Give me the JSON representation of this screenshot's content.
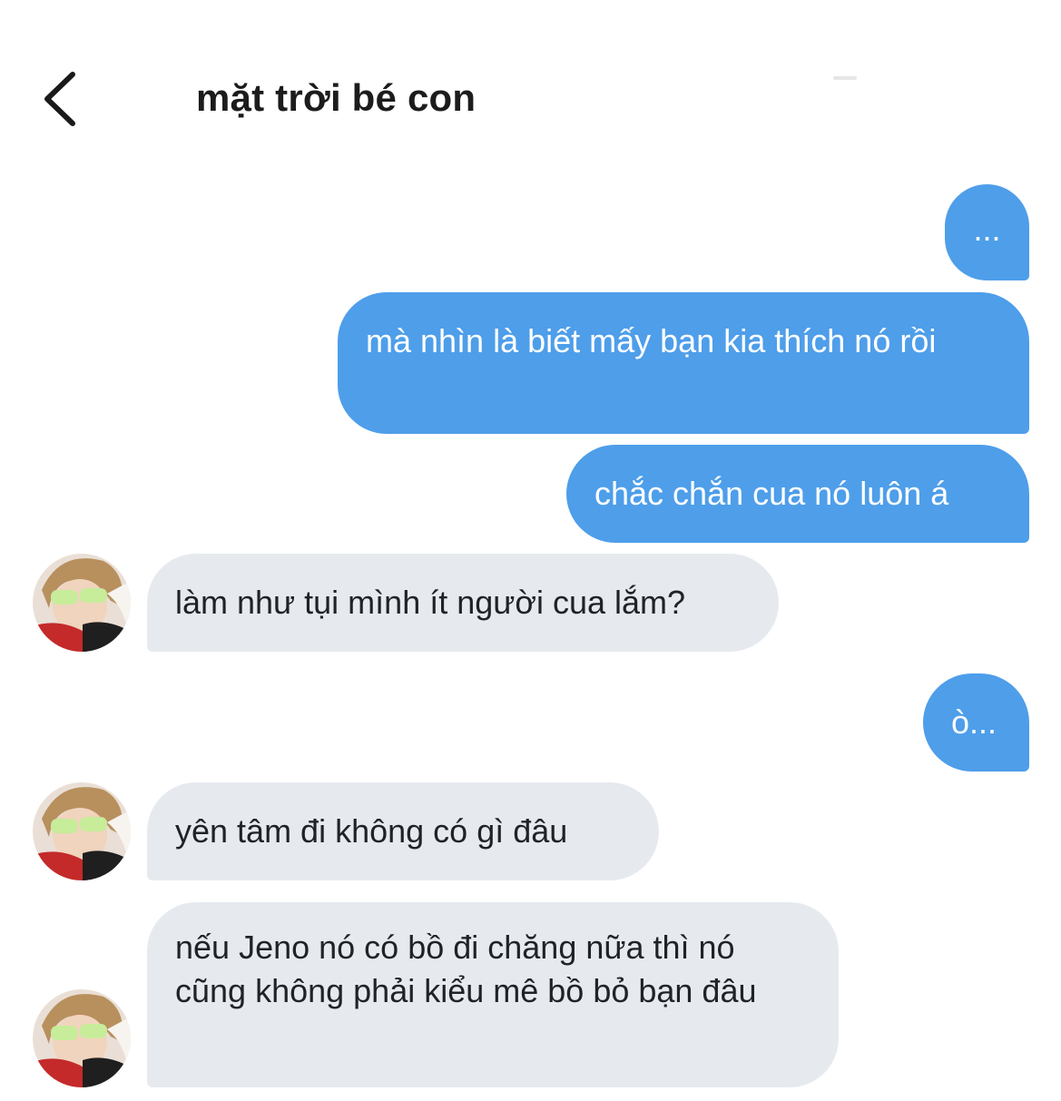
{
  "header": {
    "title": "mặt trời bé con",
    "back_icon": "chevron-left-icon"
  },
  "colors": {
    "sent_bubble": "#4e9eea",
    "received_bubble": "#e6eaef"
  },
  "messages": [
    {
      "side": "sent",
      "text": "..."
    },
    {
      "side": "sent",
      "text": "mà nhìn là biết mấy bạn kia thích nó rồi"
    },
    {
      "side": "sent",
      "text": "chắc chắn cua nó luôn á"
    },
    {
      "side": "received",
      "text": "làm như tụi mình ít người cua lắm?"
    },
    {
      "side": "sent",
      "text": "ò..."
    },
    {
      "side": "received",
      "text": "yên tâm đi không có gì đâu"
    },
    {
      "side": "received",
      "text": "nếu Jeno nó có bồ đi chăng nữa thì nó cũng không phải kiểu mê bồ bỏ bạn đâu"
    }
  ]
}
